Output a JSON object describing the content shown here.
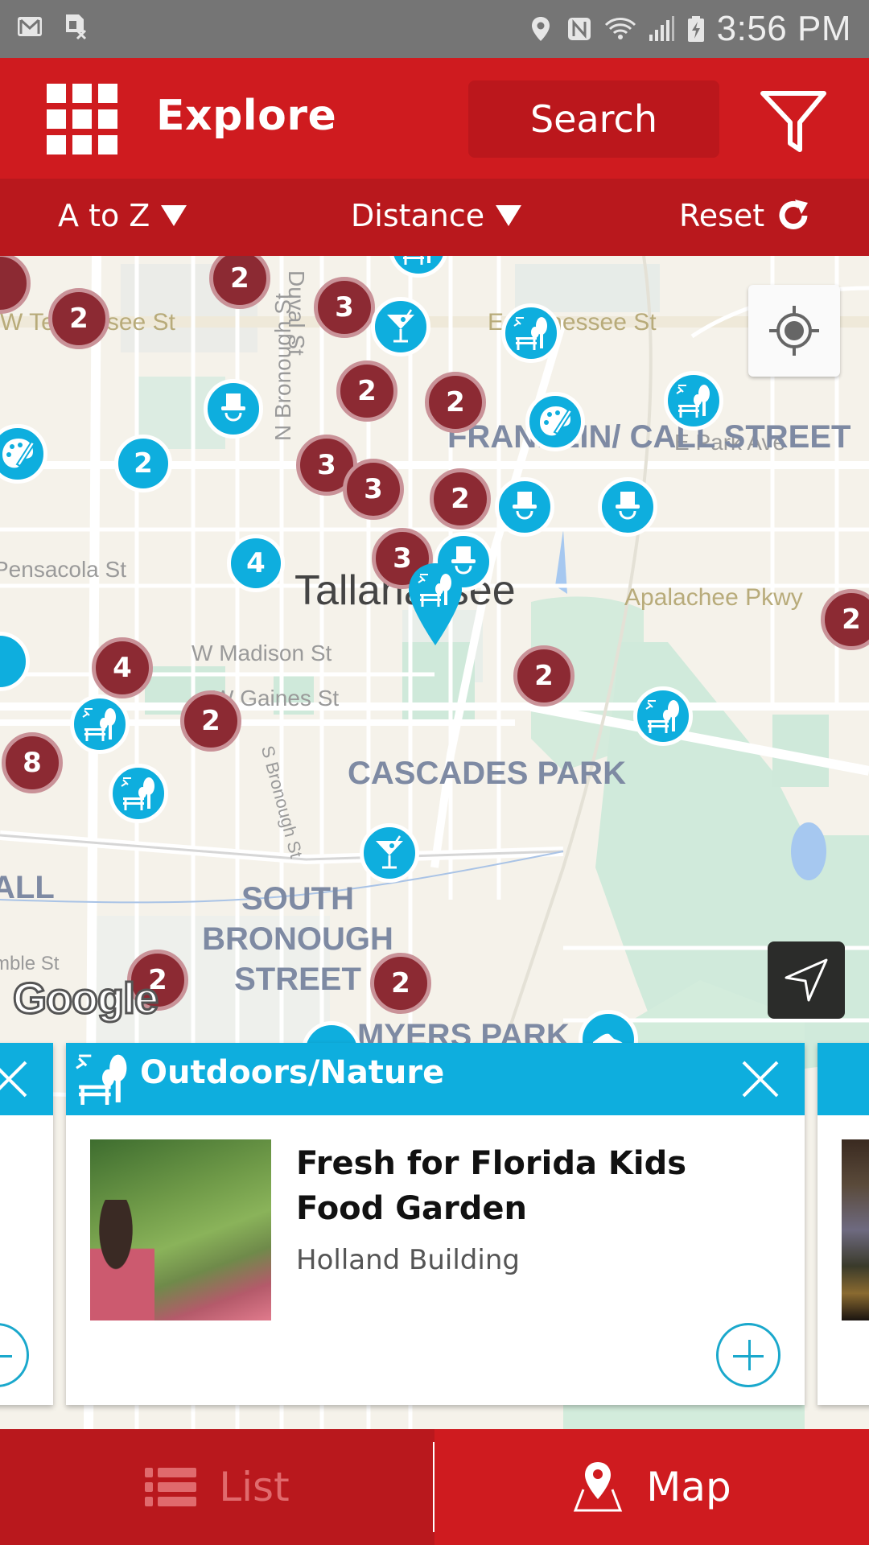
{
  "status_bar": {
    "left_icons": [
      "gmail-icon",
      "sim-card-error-icon"
    ],
    "right_icons": [
      "location-icon",
      "nfc-icon",
      "wifi-icon",
      "signal-icon",
      "battery-charging-icon"
    ],
    "time": "3:56 PM"
  },
  "header": {
    "title": "Explore",
    "search_label": "Search",
    "menu_icon": "grid-menu-icon",
    "filter_icon": "filter-icon"
  },
  "sort_bar": {
    "az_label": "A to Z",
    "distance_label": "Distance",
    "reset_label": "Reset"
  },
  "map": {
    "road_labels": [
      "W Tennessee St",
      "E Tennessee St",
      "N Bronough St",
      "Duval St",
      "E Park Ave",
      "Pensacola St",
      "W Madison St",
      "W Gaines St",
      "Apalachee Pkwy",
      "S Bronough St",
      "Gamble St"
    ],
    "area_labels": [
      "FRANKLIN/ CALL STREET",
      "CASCADES PARK",
      "SOUTH BRONOUGH STREET",
      "MYERS PARK",
      "ALL"
    ],
    "city_label": "Tallahassee",
    "clusters_red": [
      "2",
      "2",
      "3",
      "2",
      "2",
      "3",
      "3",
      "2",
      "3",
      "2",
      "4",
      "2",
      "2",
      "8",
      "2",
      "2"
    ],
    "clusters_blue": [
      "2",
      "4"
    ],
    "attribution": "Google",
    "my_location_icon": "crosshair-icon",
    "navigate_icon": "navigation-arrow-icon"
  },
  "card": {
    "category": "Outdoors/Nature",
    "title": "Fresh for Florida Kids Food Garden",
    "subtitle": "Holland Building"
  },
  "tabbar": {
    "list_label": "List",
    "map_label": "Map",
    "active": "Map"
  },
  "colors": {
    "brand_red": "#cf1b1f",
    "dark_red": "#b9181d",
    "cluster_red": "#8c2a33",
    "pin_blue": "#0eaede"
  }
}
